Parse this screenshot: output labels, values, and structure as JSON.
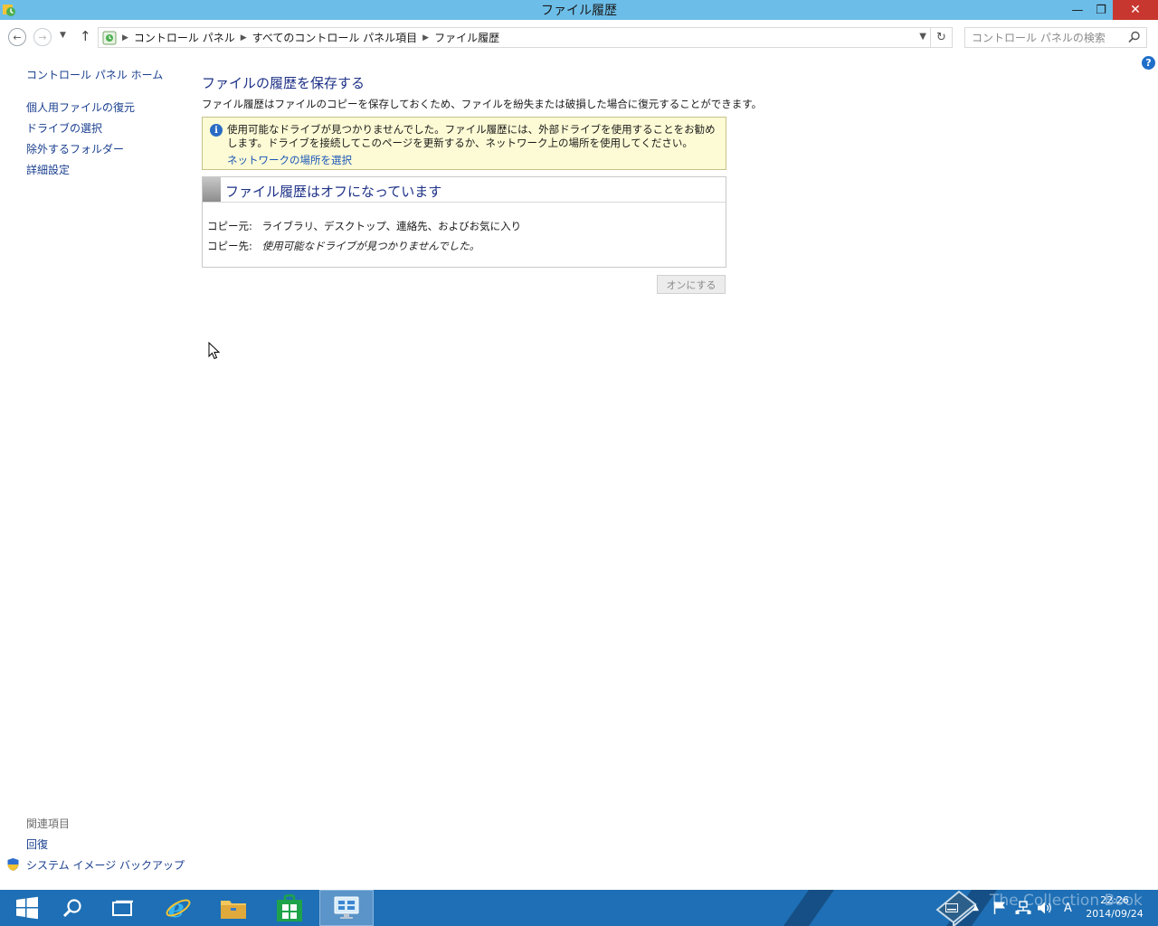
{
  "window": {
    "title": "ファイル履歴",
    "minimize_glyph": "—",
    "maximize_glyph": "❐",
    "close_glyph": "✕"
  },
  "navigation": {
    "back_icon": "back-arrow-icon",
    "forward_icon": "forward-arrow-icon",
    "up_icon": "up-arrow-icon",
    "breadcrumb": [
      "コントロール パネル",
      "すべてのコントロール パネル項目",
      "ファイル履歴"
    ],
    "search_placeholder": "コントロール パネルの検索"
  },
  "sidebar": {
    "home": "コントロール パネル ホーム",
    "items": [
      "個人用ファイルの復元",
      "ドライブの選択",
      "除外するフォルダー",
      "詳細設定"
    ],
    "related_heading": "関連項目",
    "related": [
      "回復",
      "システム イメージ バックアップ"
    ]
  },
  "main": {
    "title": "ファイルの履歴を保存する",
    "description": "ファイル履歴はファイルのコピーを保存しておくため、ファイルを紛失または破損した場合に復元することができます。",
    "info": {
      "text": "使用可能なドライブが見つかりませんでした。ファイル履歴には、外部ドライブを使用することをお勧めします。ドライブを接続してこのページを更新するか、ネットワーク上の場所を使用してください。",
      "link": "ネットワークの場所を選択"
    },
    "status": {
      "title": "ファイル履歴はオフになっています",
      "source_label": "コピー元:",
      "source_value": "ライブラリ、デスクトップ、連絡先、およびお気に入り",
      "dest_label": "コピー先:",
      "dest_value": "使用可能なドライブが見つかりませんでした。"
    },
    "turn_on_button": "オンにする"
  },
  "taskbar": {
    "apps": [
      "start-icon",
      "search-icon",
      "task-view-icon",
      "internet-explorer-icon",
      "file-explorer-icon",
      "store-icon",
      "control-panel-icon"
    ],
    "ime_indicator": "A",
    "clock_time": "22:26",
    "clock_date": "2014/09/24",
    "watermark": "The Collection Book"
  },
  "colors": {
    "titlebar": "#6cbee8",
    "taskbar": "#1e6fb5",
    "link": "#1a3f8f",
    "heading": "#1e3287",
    "info_background": "#fdfbd5"
  }
}
